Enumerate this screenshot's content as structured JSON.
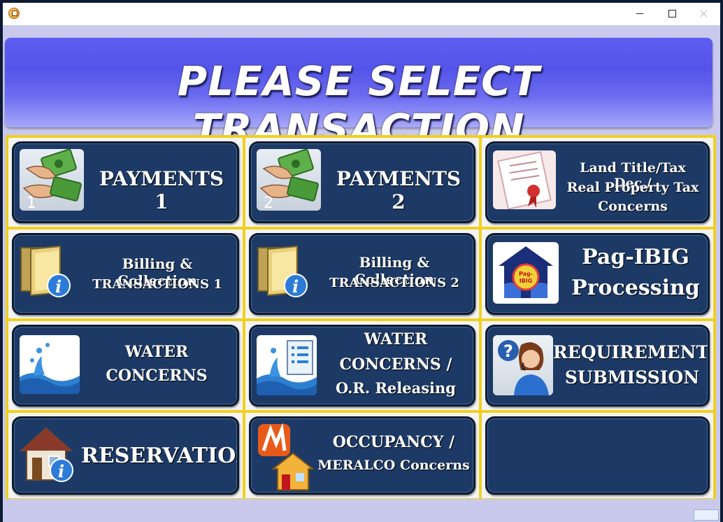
{
  "window": {
    "controls": {
      "minimize": "minimize-icon",
      "maximize": "maximize-icon",
      "close": "close-icon"
    }
  },
  "header": {
    "title": "PLEASE SELECT TRANSACTION"
  },
  "tiles": [
    {
      "line1": "PAYMENTS 1",
      "icon": "payment-hand-cash-icon",
      "badge": "1"
    },
    {
      "line1": "PAYMENTS 2",
      "icon": "payment-hand-cash-icon",
      "badge": "2"
    },
    {
      "line1": "Land Title/Tax Dec./",
      "line2": "Real Property Tax",
      "line3": "Concerns",
      "icon": "certificate-document-icon"
    },
    {
      "line1": "Billing & Collection",
      "line2": "TRANSACTIONS 1",
      "icon": "folder-info-icon"
    },
    {
      "line1": "Billing & Collection",
      "line2": "TRANSACTIONS 2",
      "icon": "folder-info-icon"
    },
    {
      "line1": "Pag-IBIG",
      "line2": "Processing",
      "icon": "pagibig-logo-icon"
    },
    {
      "line1": "WATER",
      "line2": "CONCERNS",
      "icon": "water-splash-icon"
    },
    {
      "line1": "WATER",
      "line2": "CONCERNS /",
      "line3": "O.R. Releasing",
      "icon": "water-document-icon"
    },
    {
      "line1": "REQUIREMENTS",
      "line2": "SUBMISSION",
      "icon": "support-agent-icon"
    },
    {
      "line1": "RESERVATION",
      "icon": "house-info-icon"
    },
    {
      "line1": "OCCUPANCY /",
      "line2": "MERALCO Concerns",
      "icon": "meralco-house-icon"
    },
    {
      "line1": "",
      "icon": ""
    }
  ],
  "colors": {
    "tile_bg": "#1d3a66",
    "grid_border": "#f0d020",
    "header_gradient_top": "#5454ea",
    "window_bg": "#c9c9ee"
  }
}
